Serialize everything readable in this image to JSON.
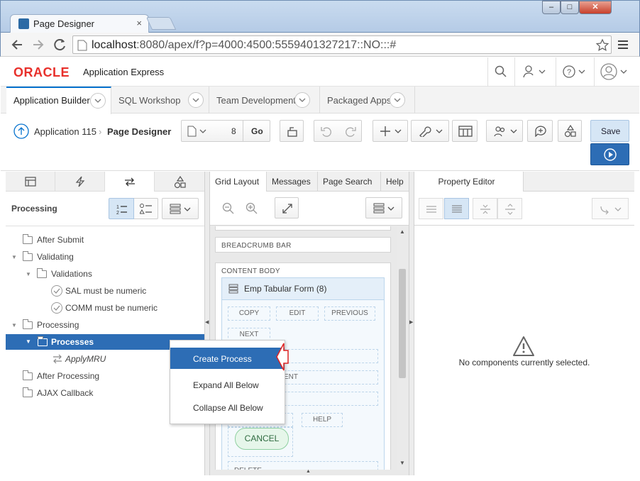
{
  "browser": {
    "tab_title": "Page Designer",
    "tab_close": "×",
    "url_host": "localhost",
    "url_rest": ":8080/apex/f?p=4000:4500:5559401327217::NO:::#"
  },
  "header": {
    "brand": "ORACLE",
    "product": "Application Express"
  },
  "nav_tabs": [
    {
      "label": "Application Builder"
    },
    {
      "label": "SQL Workshop"
    },
    {
      "label": "Team Development"
    },
    {
      "label": "Packaged Apps"
    }
  ],
  "designer": {
    "crumb_app": "Application 115",
    "crumb_page": "Page Designer",
    "page_number": "8",
    "go_label": "Go",
    "save_label": "Save"
  },
  "left": {
    "title": "Processing",
    "tree": [
      {
        "label": "After Submit"
      },
      {
        "label": "Validating"
      },
      {
        "label": "Validations"
      },
      {
        "label": "SAL must be numeric"
      },
      {
        "label": "COMM must be numeric"
      },
      {
        "label": "Processing"
      },
      {
        "label": "Processes"
      },
      {
        "label": "ApplyMRU"
      },
      {
        "label": "After Processing"
      },
      {
        "label": "AJAX Callback"
      }
    ]
  },
  "middle": {
    "tabs": [
      {
        "label": "Grid Layout"
      },
      {
        "label": "Messages"
      },
      {
        "label": "Page Search"
      },
      {
        "label": "Help"
      }
    ],
    "breadcrumb_bar": "BREADCRUMB BAR",
    "content_body": "CONTENT BODY",
    "region_title": "Emp Tabular Form (8)",
    "buttons": {
      "copy": "COPY",
      "edit": "EDIT",
      "previous": "PREVIOUS",
      "next": "NEXT",
      "ent": "ENT",
      "help": "HELP",
      "cancel": "CANCEL",
      "delete": "DELETE"
    }
  },
  "right": {
    "tab": "Property Editor",
    "empty_message": "No components currently selected."
  },
  "context_menu": [
    {
      "label": "Create Process"
    },
    {
      "label": "Expand All Below"
    },
    {
      "label": "Collapse All Below"
    }
  ],
  "colors": {
    "accent": "#0572ce",
    "selection": "#2d6db5",
    "brand": "#e8302b",
    "save_bg": "#d6e6f5",
    "run_bg": "#2d6db5"
  }
}
